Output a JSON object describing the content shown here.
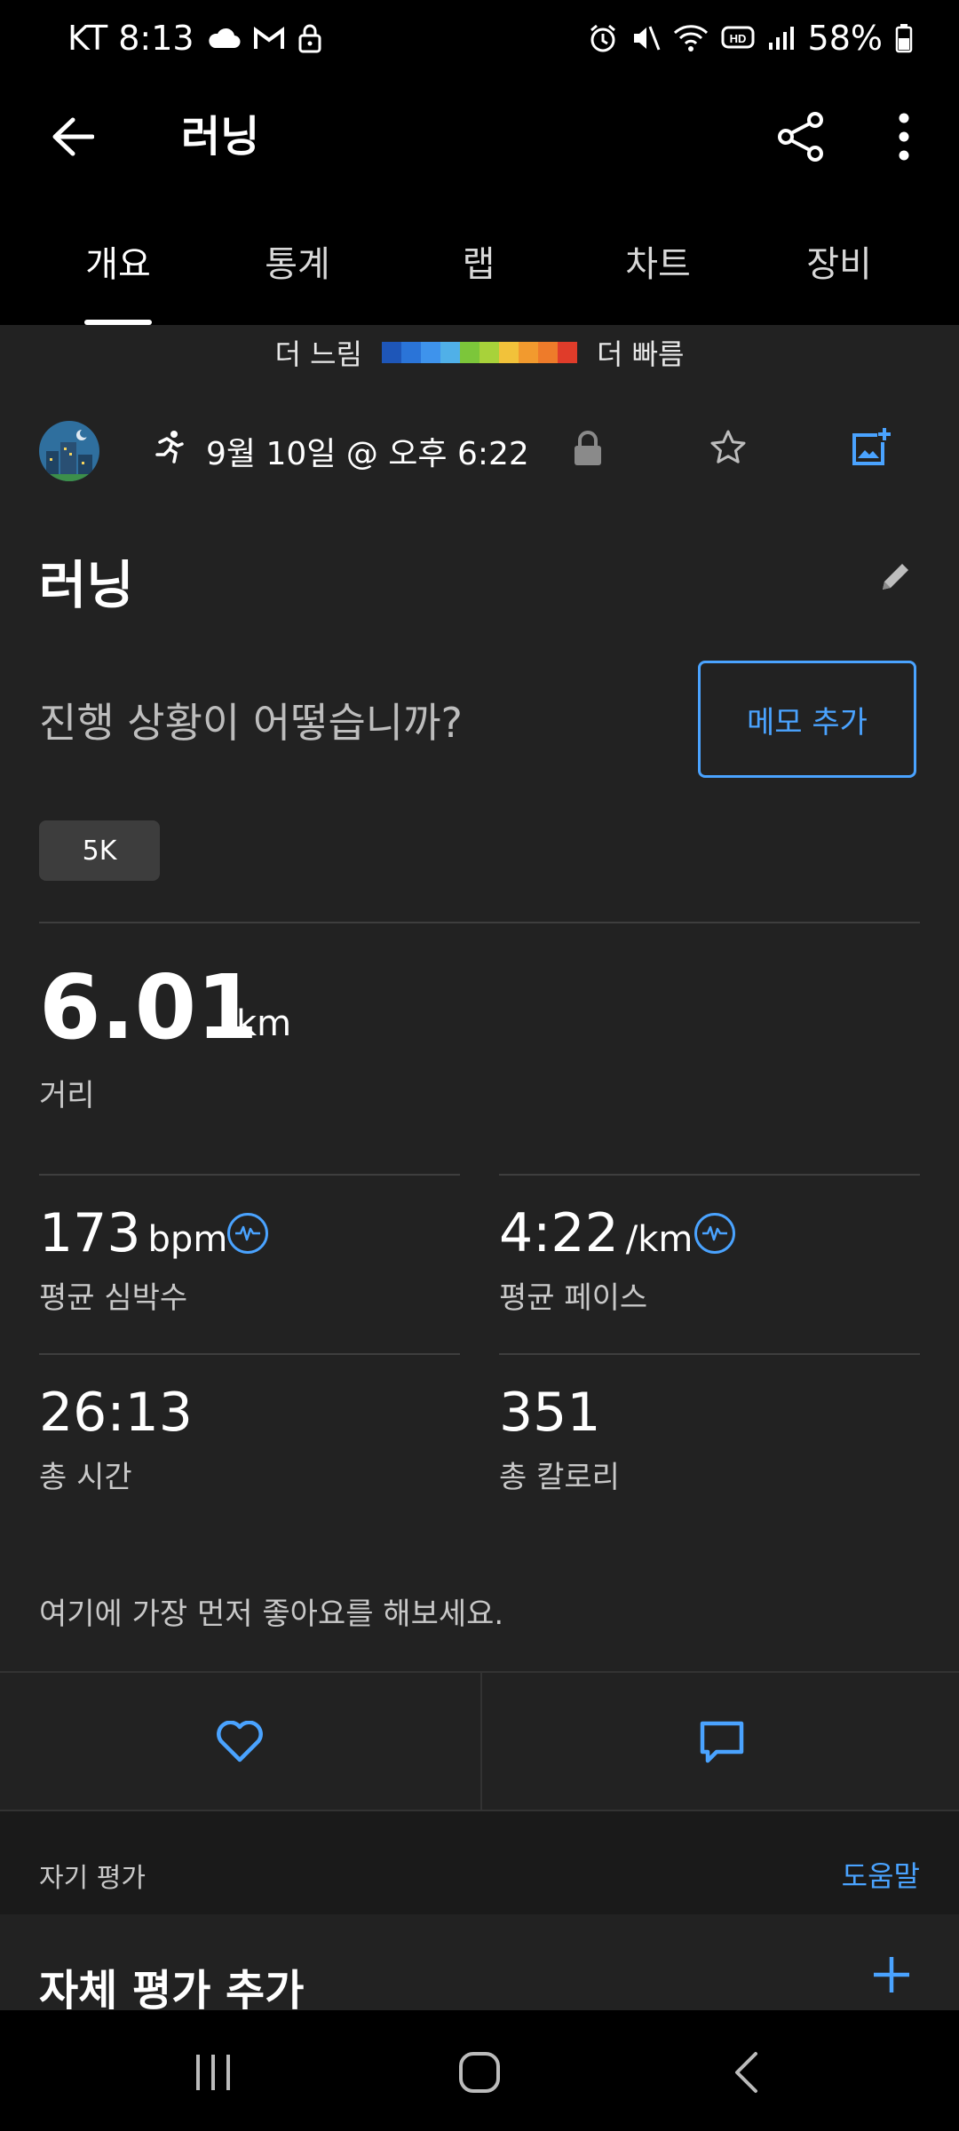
{
  "status_bar": {
    "carrier_time": "KT 8:13",
    "battery": "58%",
    "icons_left": [
      "cloud-icon",
      "gmail-icon",
      "lock-icon"
    ],
    "icons_right": [
      "alarm-icon",
      "mute-icon",
      "wifi-icon",
      "hd-icon",
      "signal-icon",
      "battery-icon"
    ]
  },
  "app_bar": {
    "title": "러닝"
  },
  "tabs": [
    {
      "label": "개요",
      "active": true
    },
    {
      "label": "통계",
      "active": false
    },
    {
      "label": "랩",
      "active": false
    },
    {
      "label": "차트",
      "active": false
    },
    {
      "label": "장비",
      "active": false
    }
  ],
  "pace_legend": {
    "slow_label": "더 느림",
    "fast_label": "더 빠름",
    "colors": [
      "#1e56b8",
      "#2a74d8",
      "#3e93ec",
      "#50b0e8",
      "#7cc63a",
      "#a8d23a",
      "#f2c23a",
      "#f29a2e",
      "#ee7b2a",
      "#e03c2a"
    ]
  },
  "activity": {
    "date_time": "9월 10일 @ 오후 6:22",
    "name": "러닝",
    "prompt": "진행 상황이 어떻습니까?",
    "memo_button": "메모 추가",
    "tag": "5K"
  },
  "stats": {
    "distance": {
      "value": "6.01",
      "unit": "km",
      "label": "거리"
    },
    "avg_hr": {
      "value": "173",
      "unit": "bpm",
      "label": "평균 심박수"
    },
    "avg_pace": {
      "value": "4:22",
      "unit": "/km",
      "label": "평균 페이스"
    },
    "total_time": {
      "value": "26:13",
      "label": "총 시간"
    },
    "calories": {
      "value": "351",
      "label": "총 칼로리"
    }
  },
  "social": {
    "kudos_prompt": "여기에 가장 먼저 좋아요를 해보세요."
  },
  "self_evaluation": {
    "section_title": "자기 평가",
    "help_link": "도움말",
    "add_label": "자체 평가 추가"
  },
  "colors": {
    "accent": "#4aa3ff",
    "background": "#222222",
    "bar_background": "#000000"
  }
}
